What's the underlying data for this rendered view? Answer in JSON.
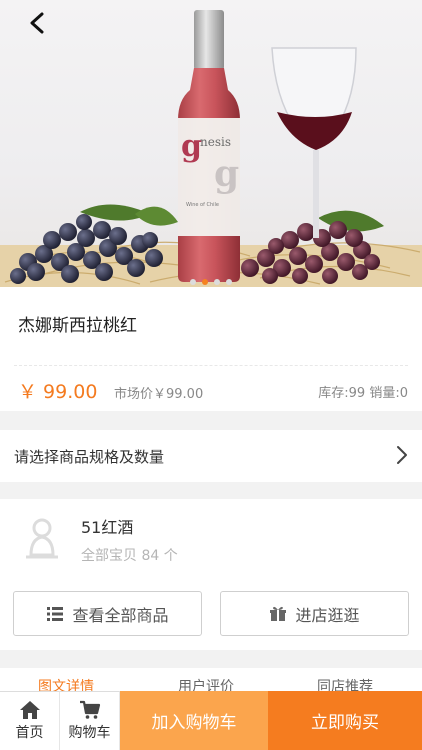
{
  "product": {
    "title": "杰娜斯西拉桃红",
    "price": "￥ 99.00",
    "market_price": "市场价￥99.00",
    "stock_sales": "库存:99 销量:0",
    "bottle_label": "gnesis"
  },
  "carousel": {
    "count": 4,
    "active": 1
  },
  "spec": {
    "label": "请选择商品规格及数量"
  },
  "shop": {
    "name": "51红酒",
    "items_count": "全部宝贝 84 个",
    "view_all_label": "查看全部商品",
    "enter_store_label": "进店逛逛"
  },
  "tabs": [
    {
      "label": "图文详情",
      "active": true
    },
    {
      "label": "用户评价",
      "active": false
    },
    {
      "label": "同店推荐",
      "active": false
    }
  ],
  "bottom_bar": {
    "home_label": "首页",
    "cart_label": "购物车",
    "add_to_cart_label": "加入购物车",
    "buy_now_label": "立即购买"
  },
  "colors": {
    "accent": "#f47b20",
    "add_cart_bg": "#fba54d",
    "buy_bg": "#f57c1f"
  }
}
